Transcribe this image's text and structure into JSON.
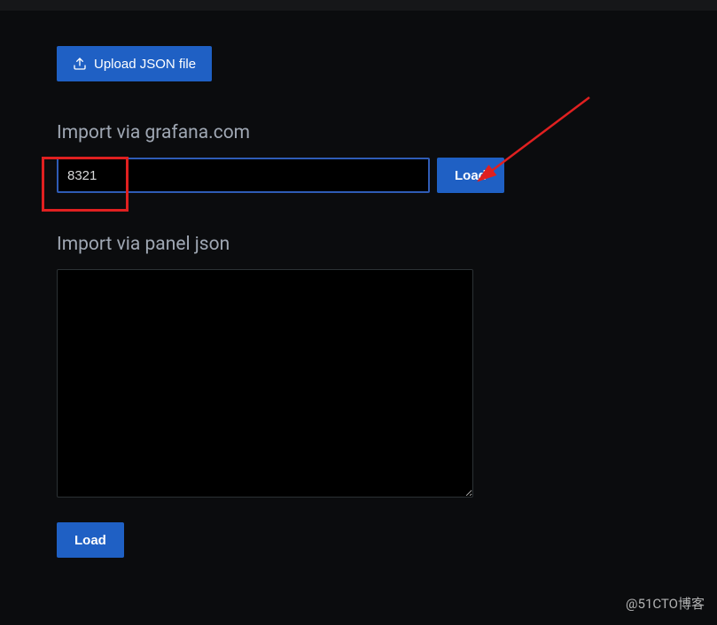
{
  "upload": {
    "label": "Upload JSON file"
  },
  "grafana_import": {
    "heading": "Import via grafana.com",
    "value": "8321",
    "placeholder": "",
    "load_label": "Load"
  },
  "panel_import": {
    "heading": "Import via panel json",
    "value": "",
    "load_label": "Load"
  },
  "watermark": "@51CTO博客"
}
